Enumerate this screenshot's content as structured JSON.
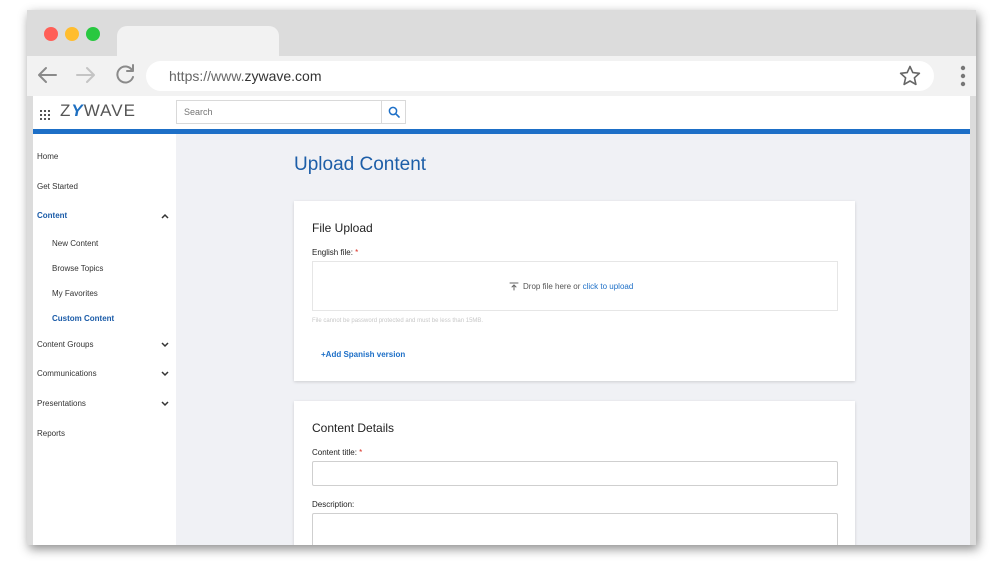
{
  "browser": {
    "url_prefix": "https://www.",
    "url_host": "zywave",
    "url_suffix": ".com"
  },
  "header": {
    "logo_left": "Z",
    "logo_y": "Y",
    "logo_right": "WAVE",
    "search_placeholder": "Search"
  },
  "sidebar": {
    "items": [
      {
        "label": "Home"
      },
      {
        "label": "Get Started"
      },
      {
        "label": "Content"
      },
      {
        "label": "Content Groups"
      },
      {
        "label": "Communications"
      },
      {
        "label": "Presentations"
      },
      {
        "label": "Reports"
      }
    ],
    "content_sub": [
      {
        "label": "New Content"
      },
      {
        "label": "Browse Topics"
      },
      {
        "label": "My Favorites"
      },
      {
        "label": "Custom Content"
      }
    ]
  },
  "main": {
    "page_title": "Upload Content",
    "file_upload": {
      "title": "File Upload",
      "english_label": "English file:",
      "required_mark": "*",
      "drop_text": "Drop file here or ",
      "drop_link": "click to upload",
      "hint": "File cannot be password protected and must be less than 15MB.",
      "add_spanish": "+Add Spanish version"
    },
    "content_details": {
      "title": "Content Details",
      "content_title_label": "Content title:",
      "required_mark": "*",
      "description_label": "Description:"
    }
  },
  "colors": {
    "brand_blue": "#1d6fc7",
    "active_nav": "#1a5ba8",
    "required": "#d93025"
  }
}
